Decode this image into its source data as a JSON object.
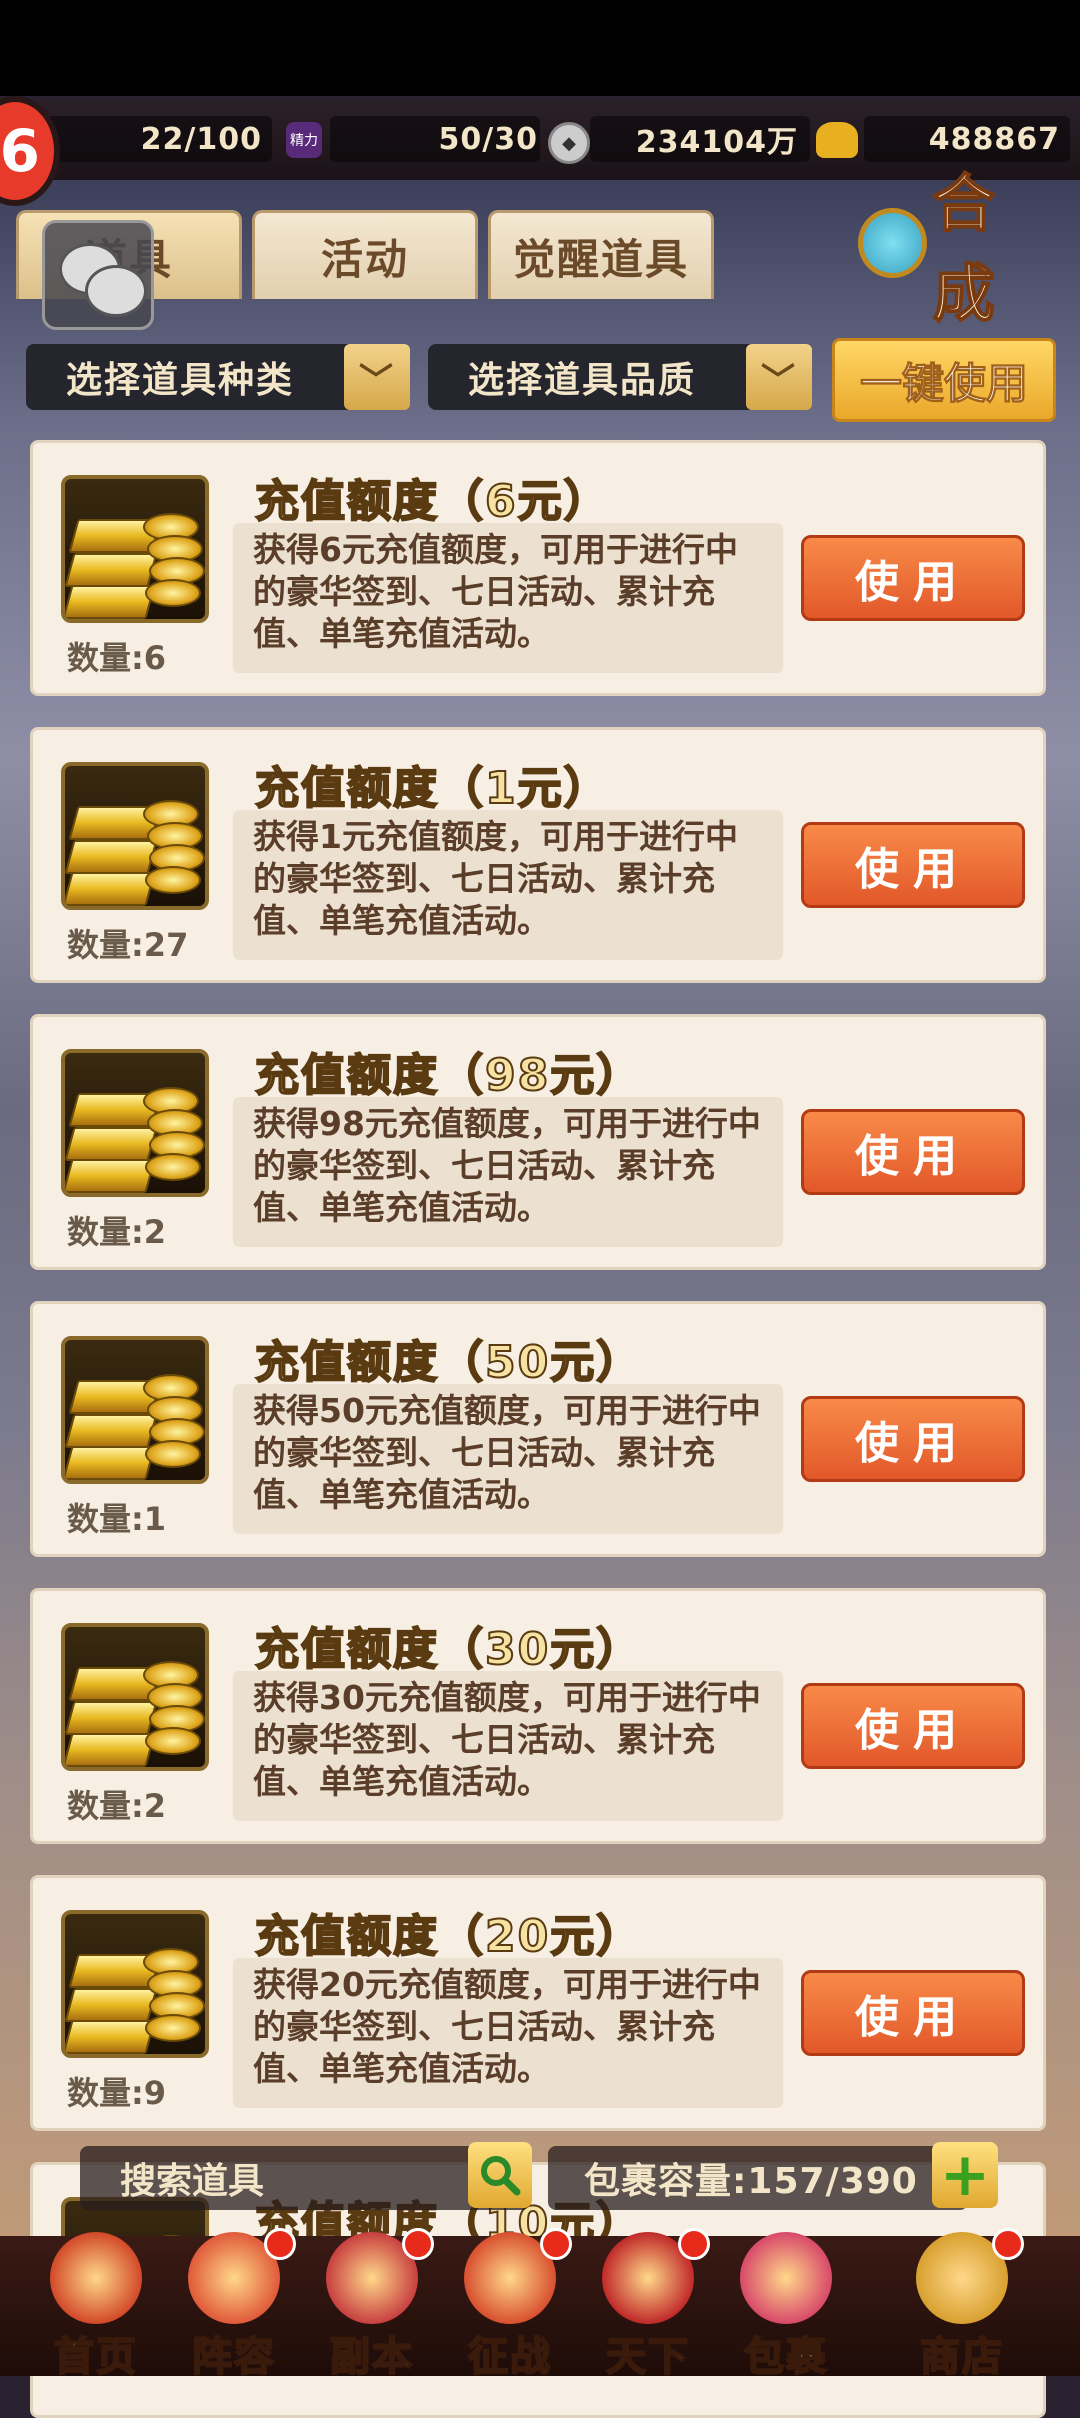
{
  "resources": {
    "stamina": "22/100",
    "energy_icon_label": "精力",
    "energy": "50/30",
    "copper": "234104万",
    "gold": "488867"
  },
  "badge_number": "6",
  "tabs": [
    {
      "label": "道具",
      "active": true
    },
    {
      "label": "活动",
      "active": false
    },
    {
      "label": "觉醒道具",
      "active": false
    }
  ],
  "synth_label": "合成",
  "filters": {
    "type_label": "选择道具种类",
    "quality_label": "选择道具品质",
    "use_all_label": "一键使用"
  },
  "items": [
    {
      "title": "充值额度（6元）",
      "desc": "获得6元充值额度，可用于进行中的豪华签到、七日活动、累计充值、单笔充值活动。",
      "qty": "数量:6",
      "button": "使用"
    },
    {
      "title": "充值额度（1元）",
      "desc": "获得1元充值额度，可用于进行中的豪华签到、七日活动、累计充值、单笔充值活动。",
      "qty": "数量:27",
      "button": "使用"
    },
    {
      "title": "充值额度（98元）",
      "desc": "获得98元充值额度，可用于进行中的豪华签到、七日活动、累计充值、单笔充值活动。",
      "qty": "数量:2",
      "button": "使用"
    },
    {
      "title": "充值额度（50元）",
      "desc": "获得50元充值额度，可用于进行中的豪华签到、七日活动、累计充值、单笔充值活动。",
      "qty": "数量:1",
      "button": "使用"
    },
    {
      "title": "充值额度（30元）",
      "desc": "获得30元充值额度，可用于进行中的豪华签到、七日活动、累计充值、单笔充值活动。",
      "qty": "数量:2",
      "button": "使用"
    },
    {
      "title": "充值额度（20元）",
      "desc": "获得20元充值额度，可用于进行中的豪华签到、七日活动、累计充值、单笔充值活动。",
      "qty": "数量:9",
      "button": "使用"
    },
    {
      "title": "充值额度（10元）"
    }
  ],
  "search_placeholder": "搜索道具",
  "capacity": "包裹容量:157/390",
  "nav": [
    {
      "label": "首页",
      "icon": "palace-icon",
      "dot": false
    },
    {
      "label": "阵容",
      "icon": "formation-icon",
      "dot": true
    },
    {
      "label": "副本",
      "icon": "dungeon-icon",
      "dot": true
    },
    {
      "label": "征战",
      "icon": "battle-icon",
      "dot": true
    },
    {
      "label": "天下",
      "icon": "world-icon",
      "dot": true
    },
    {
      "label": "包裹",
      "icon": "bag-icon",
      "dot": false,
      "active": true
    },
    {
      "label": "商店",
      "icon": "shop-icon",
      "dot": true
    }
  ],
  "colors": {
    "use_button": "#e2582a",
    "title_gold": "#f6e2a2",
    "card_bg": "#f7efe4"
  }
}
